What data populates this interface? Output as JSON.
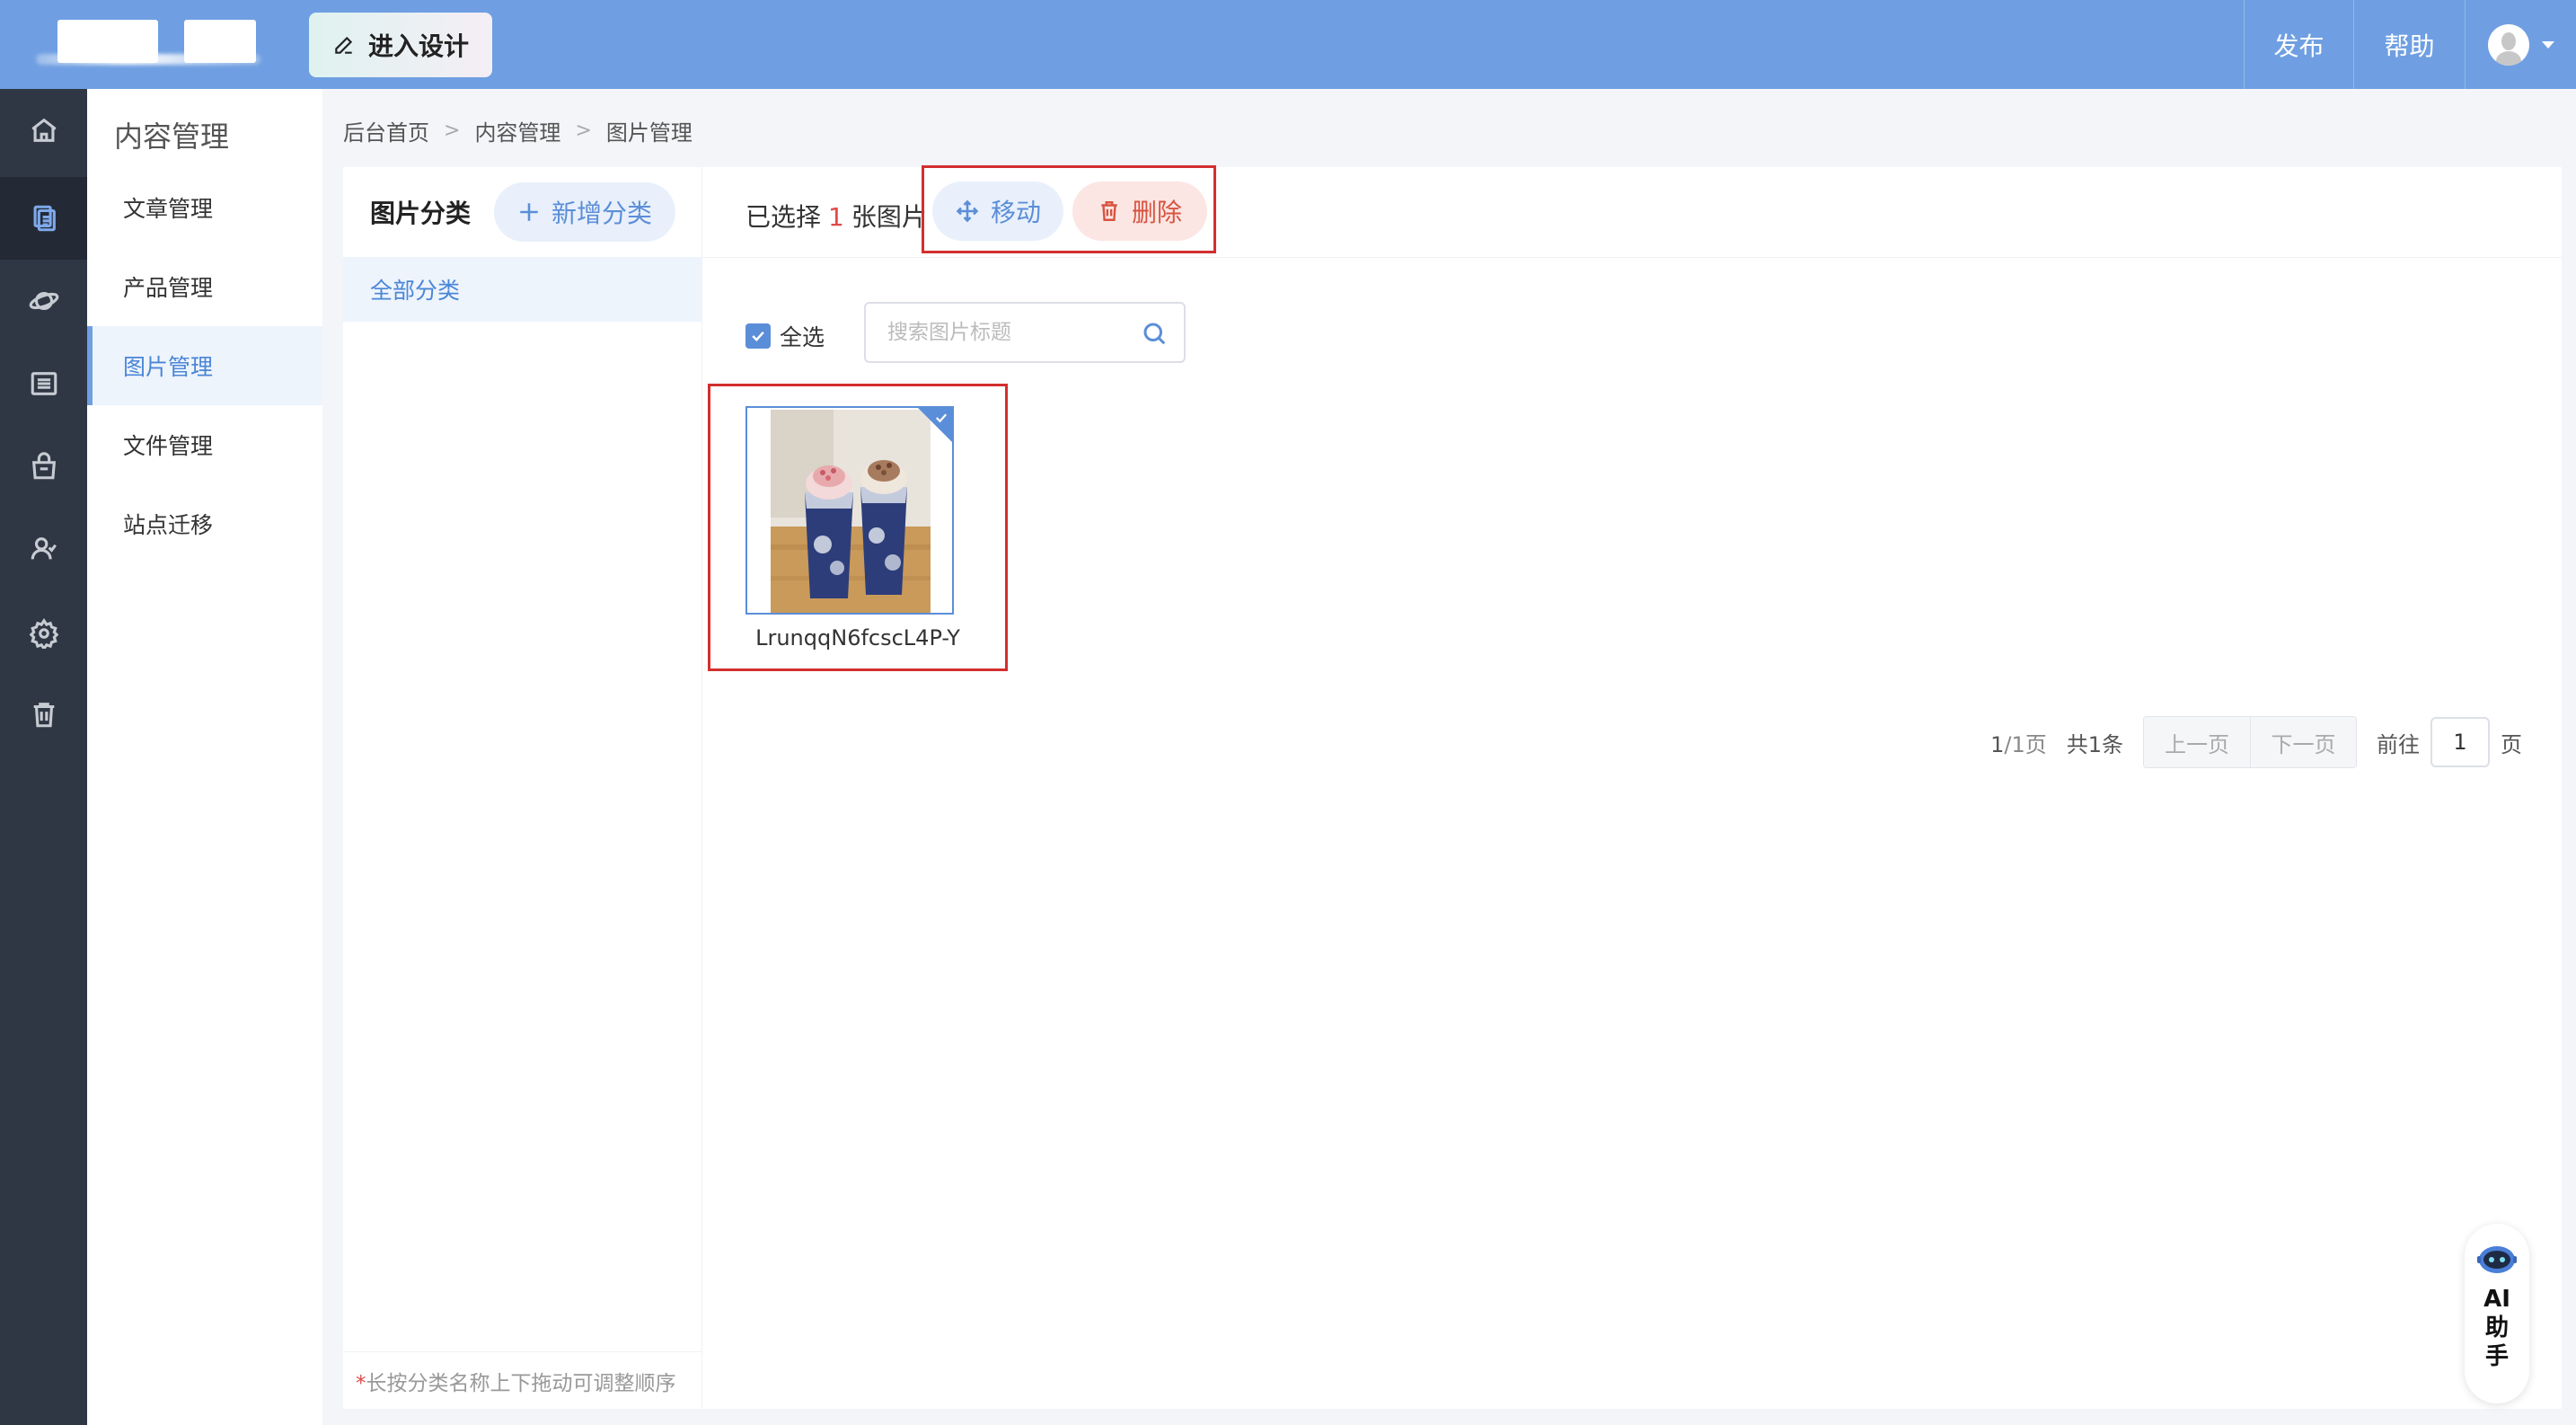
{
  "topbar": {
    "design_button": "进入设计",
    "publish": "发布",
    "help": "帮助"
  },
  "leftnav": {
    "icons": [
      "home-icon",
      "content-icon",
      "planet-icon",
      "list-icon",
      "shop-icon",
      "member-icon",
      "settings-icon",
      "trash-icon"
    ],
    "active": "content-icon"
  },
  "submenu": {
    "title": "内容管理",
    "items": [
      {
        "label": "文章管理"
      },
      {
        "label": "产品管理"
      },
      {
        "label": "图片管理"
      },
      {
        "label": "文件管理"
      },
      {
        "label": "站点迁移"
      }
    ],
    "active_index": 2
  },
  "breadcrumb": [
    "后台首页",
    "内容管理",
    "图片管理"
  ],
  "category": {
    "title": "图片分类",
    "add_button": "新增分类",
    "all": "全部分类",
    "tip": "长按分类名称上下拖动可调整顺序"
  },
  "toolbar": {
    "selected_prefix": "已选择",
    "selected_count": "1",
    "selected_suffix": "张图片",
    "move_button": "移动",
    "delete_button": "删除",
    "select_all": "全选",
    "search_placeholder": "搜索图片标题"
  },
  "images": [
    {
      "name": "LrunqqN6fcscL4P-Y",
      "selected": true
    }
  ],
  "pager": {
    "page_info_cur": "1",
    "page_info_rest": "/1页",
    "total": "共1条",
    "prev": "上一页",
    "next": "下一页",
    "goto": "前往",
    "page_value": "1",
    "page_suffix": "页"
  },
  "ai_helper": {
    "label": "AI助手"
  },
  "colors": {
    "topbar": "#6f9fe2",
    "nav": "#2f3744",
    "accent": "#5b8ed8",
    "danger": "#d8533f",
    "highlight_frame": "#d32f2f"
  }
}
